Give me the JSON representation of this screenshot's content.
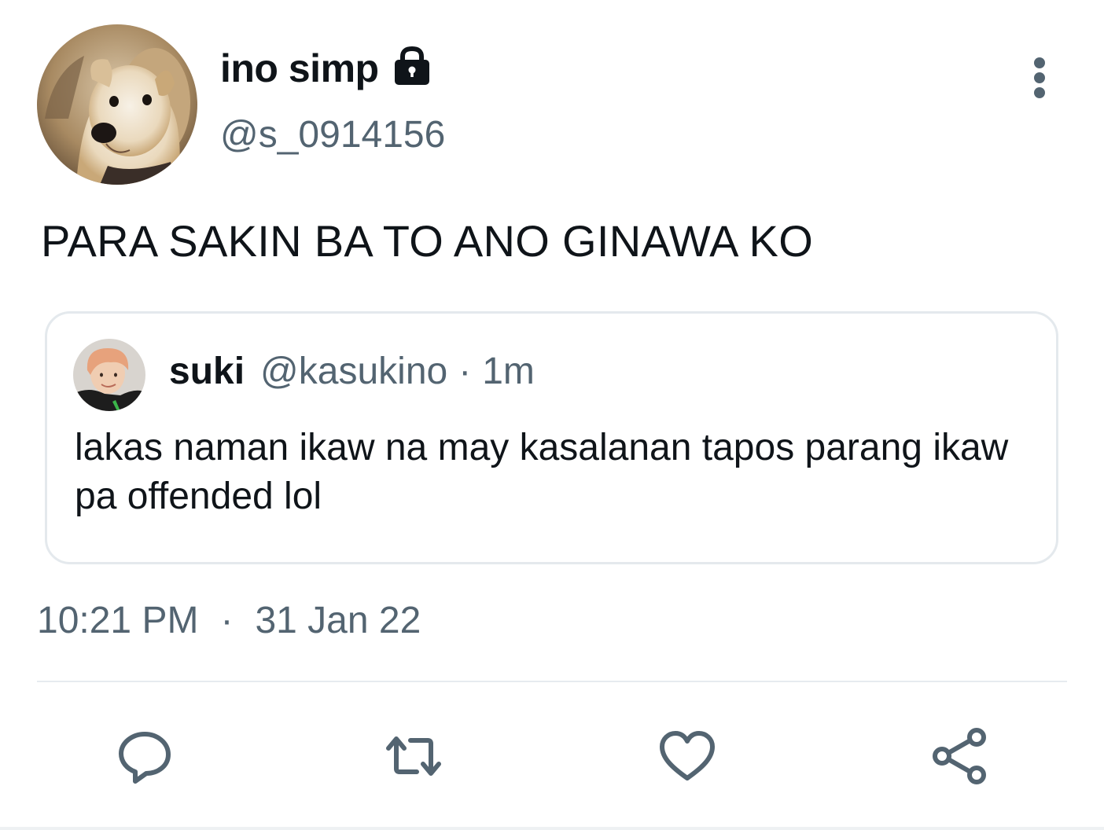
{
  "tweet": {
    "author": {
      "display_name": "ino simp",
      "handle": "@s_0914156",
      "protected_icon": "lock-icon",
      "avatar": "dog-photo-avatar"
    },
    "text": "PARA SAKIN BA TO ANO GINAWA KO",
    "menu_icon": "more-vertical-icon",
    "quoted_tweet": {
      "display_name": "suki",
      "handle": "@kasukino",
      "separator": "·",
      "time_ago": "1m",
      "text": "lakas naman ikaw na may kasalanan tapos parang ikaw pa offended lol",
      "avatar": "person-photo-avatar"
    },
    "timestamp": {
      "time": "10:21 PM",
      "separator": "·",
      "date": "31 Jan 22"
    },
    "actions": [
      {
        "name": "reply",
        "icon": "reply-icon"
      },
      {
        "name": "retweet",
        "icon": "retweet-icon"
      },
      {
        "name": "like",
        "icon": "heart-icon"
      },
      {
        "name": "share",
        "icon": "share-icon"
      }
    ]
  },
  "colors": {
    "text_primary": "#0f1419",
    "text_secondary": "#536471",
    "border": "#e4e9ed",
    "icon": "#536471"
  }
}
